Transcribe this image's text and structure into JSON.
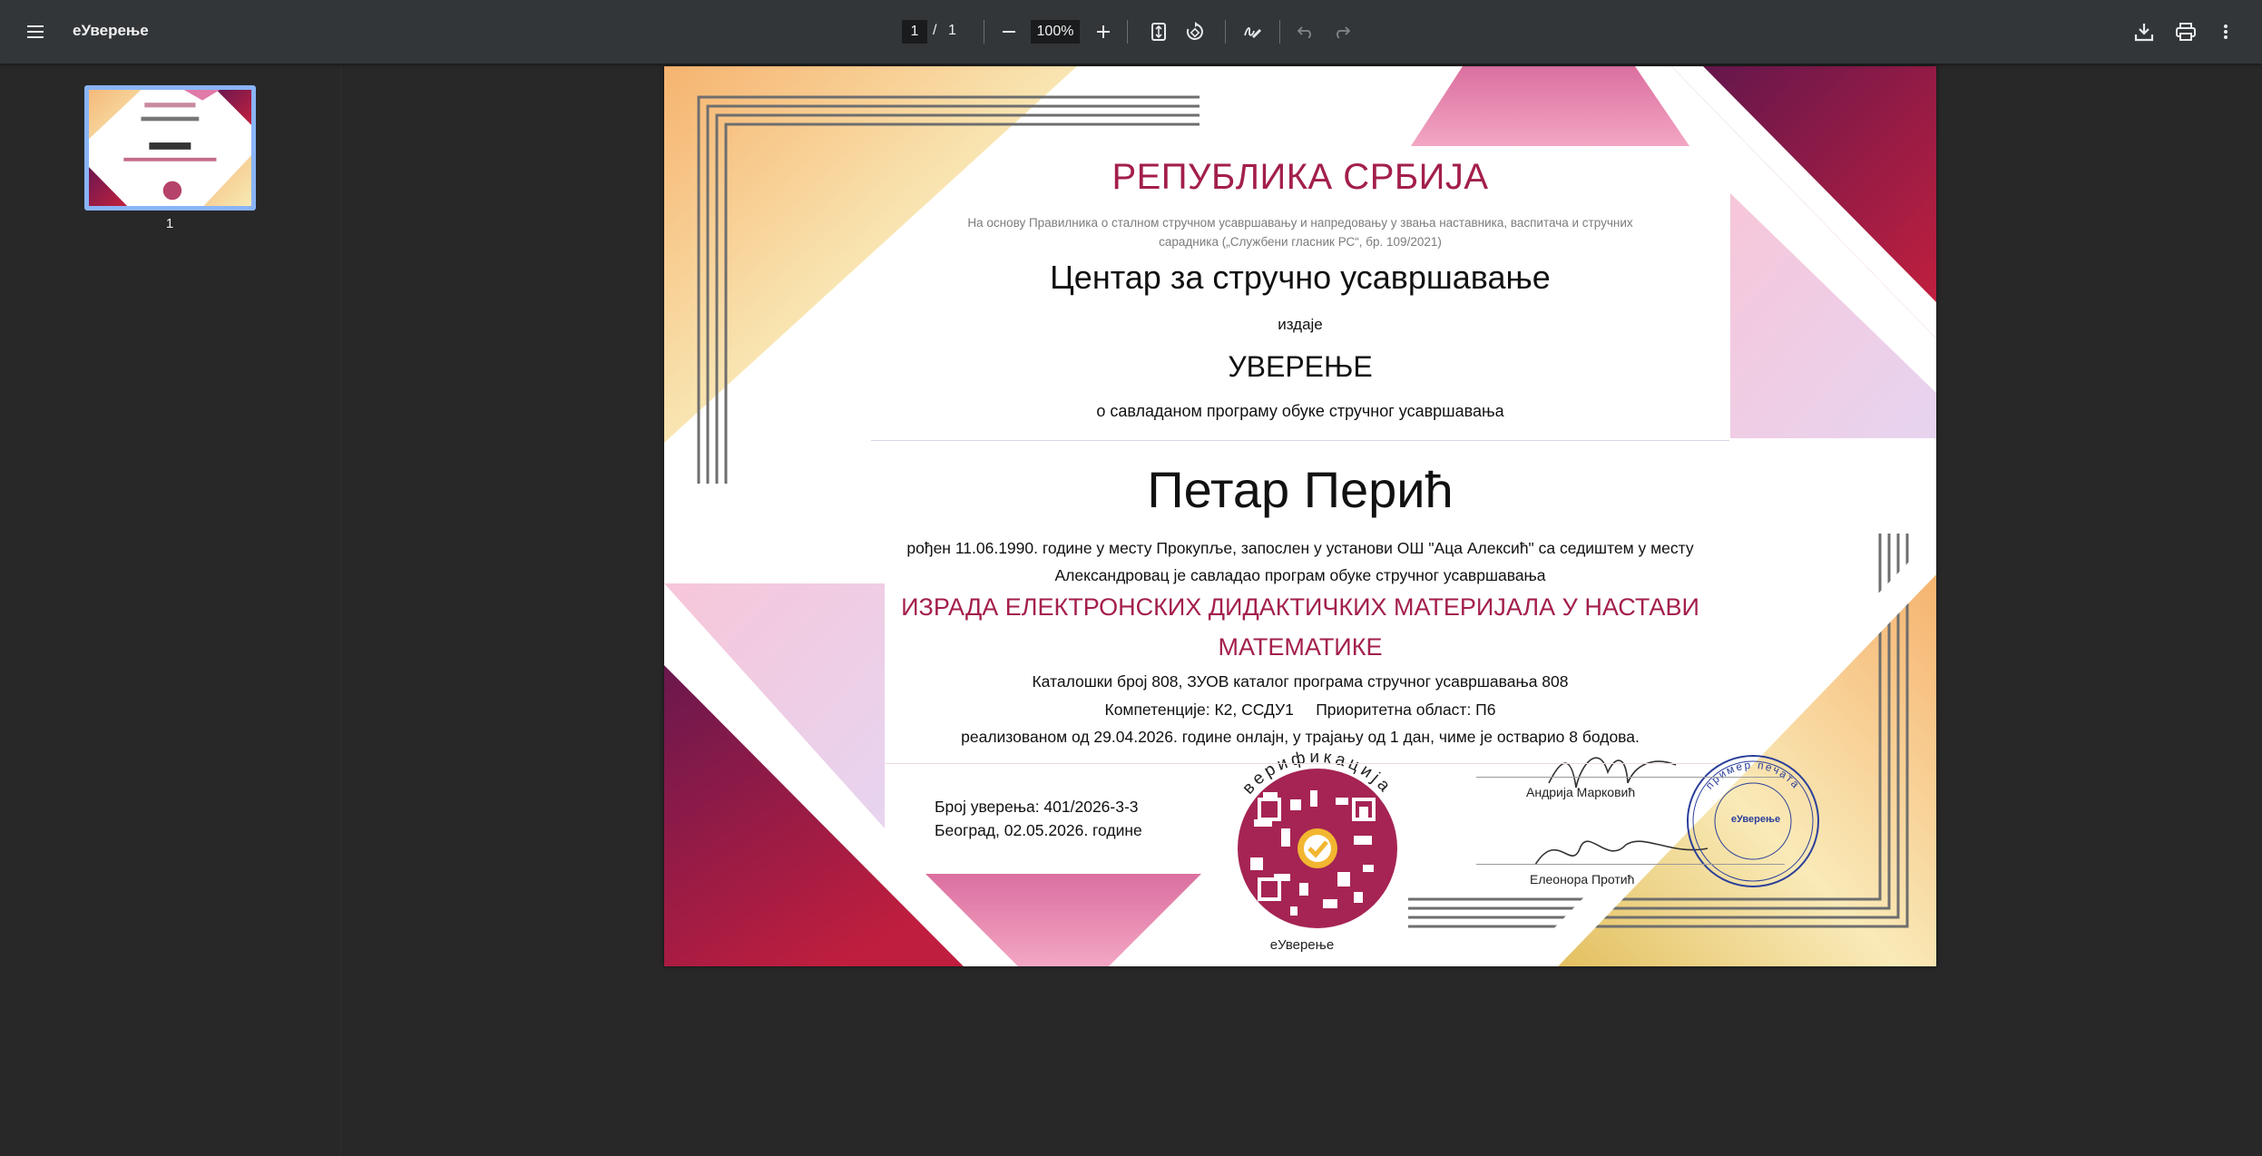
{
  "app": {
    "title": "еУверење",
    "page_current": "1",
    "page_sep": "/",
    "page_total": "1",
    "zoom": "100%",
    "thumbnail_label": "1"
  },
  "icons": {
    "menu": "menu-icon",
    "zoom_out": "minus-icon",
    "zoom_in": "plus-icon",
    "fit": "fit-page-icon",
    "rotate": "rotate-icon",
    "annotate": "annotate-pen-icon",
    "undo": "undo-icon",
    "redo": "redo-icon",
    "download": "download-icon",
    "print": "print-icon",
    "more": "more-vert-icon"
  },
  "certificate": {
    "republic": "РЕПУБЛИКА СРБИЈА",
    "legal_basis": "На основу Правилника о сталном стручном усавршавању и напредовању у звања наставника, васпитача и стручних сарадника („Службени гласник РС“, бр. 109/2021)",
    "organization": "Центар за стручно усавршавање",
    "issues": "издаје",
    "title": "УВЕРЕЊЕ",
    "subtitle": "о савладаном програму обуке стручног усавршавања",
    "name": "Петар Перић",
    "bio": "рођен 11.06.1990. године у месту Прокупље, запослен у установи ОШ \"Аца Алексић\" са седиштем у месту Александровац је савладао програм обуке стручног усавршавања",
    "program": "ИЗРАДА ЕЛЕКТРОНСКИХ ДИДАКТИЧКИХ МАТЕРИЈАЛА У НАСТАВИ МАТЕМАТИКЕ",
    "catalog": "Каталошки број 808, ЗУОВ каталог програма стручног усавршавања 808",
    "competences": "Компетенције: К2, ССДУ1     Приоритетна област: П6",
    "realized": "реализованом од 29.04.2026. године онлајн, у трајању од 1 дан, чиме је остварио 8 бодова.",
    "cert_number": "Број уверења: 401/2026-3-3",
    "place_date": "Београд, 02.05.2026. године",
    "verification_arc": "верификација",
    "verification_label": "еУверење",
    "signer1": "Андрија Марковић",
    "signer2": "Елеонора Протић",
    "stamp_center": "еУверење",
    "stamp_arc": "пример печата"
  },
  "colors": {
    "accent": "#a31f4b",
    "toolbar_bg": "#323639",
    "viewer_bg": "#282828",
    "thumb_border": "#8ab4f8",
    "stamp": "#2b3f9a"
  }
}
